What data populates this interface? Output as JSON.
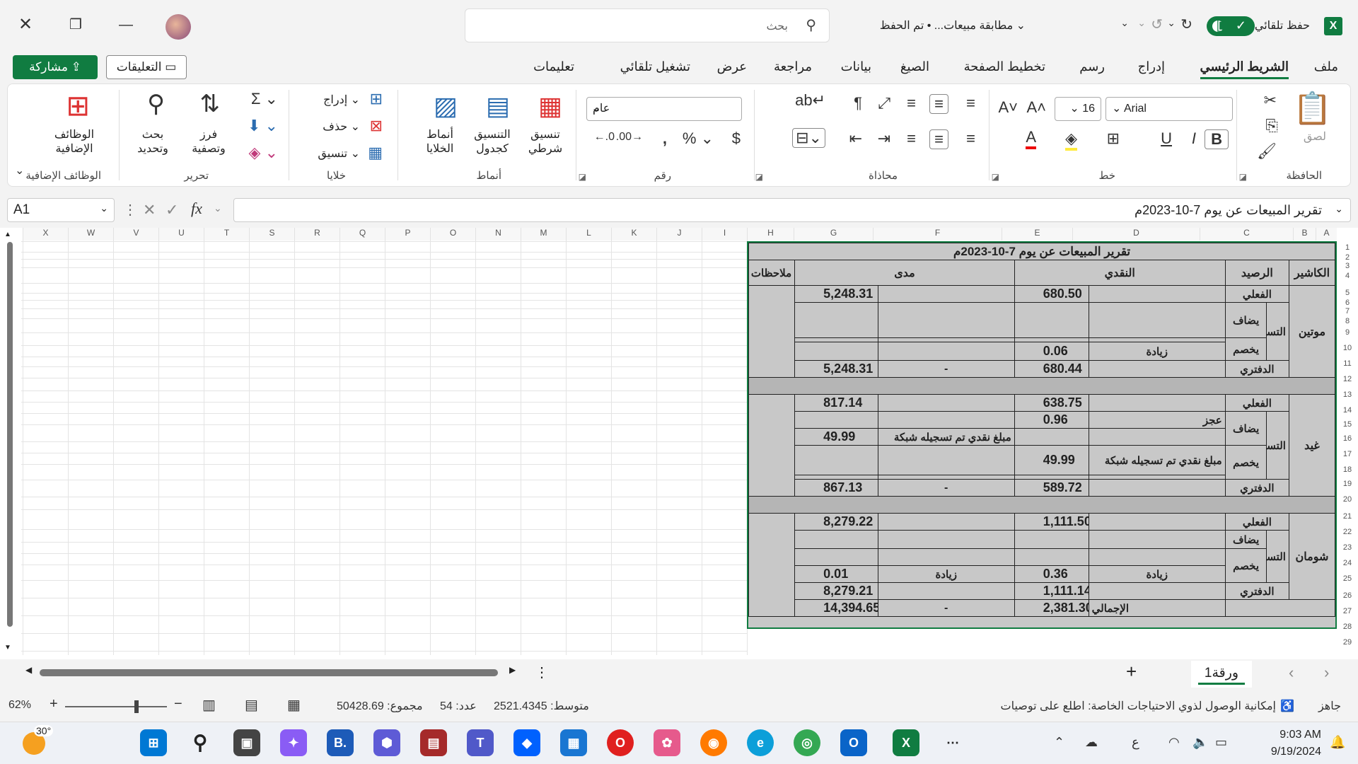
{
  "titlebar": {
    "autosave_label": "حفظ تلقائي",
    "doc_title": "مطابقة مبيعات...",
    "save_state": "• تم الحفظ",
    "search_placeholder": "بحث"
  },
  "tabs": [
    "ملف",
    "الشريط الرئيسي",
    "إدراج",
    "رسم",
    "تخطيط الصفحة",
    "الصيغ",
    "بيانات",
    "مراجعة",
    "عرض",
    "تشغيل تلقائي",
    "تعليمات"
  ],
  "actions": {
    "share": "مشاركة",
    "comments": "التعليقات"
  },
  "ribbon": {
    "clipboard": {
      "label": "الحافظة",
      "paste": "لصق"
    },
    "font": {
      "label": "خط",
      "name": "Arial",
      "size": "16"
    },
    "alignment": {
      "label": "محاذاة"
    },
    "number": {
      "label": "رقم",
      "format": "عام"
    },
    "styles": {
      "label": "أنماط",
      "conditional": "تنسيق شرطي",
      "table": "التنسيق كجدول",
      "cell": "أنماط الخلايا"
    },
    "cells": {
      "label": "خلايا",
      "insert": "إدراج",
      "delete": "حذف",
      "format": "تنسيق"
    },
    "editing": {
      "label": "تحرير",
      "sort": "فرز وتصفية",
      "find": "بحث وتحديد"
    },
    "addins": {
      "label": "الوظائف الإضافية",
      "button": "الوظائف الإضافية"
    }
  },
  "formula_bar": {
    "namebox": "A1",
    "value": "تقرير المبيعات عن يوم 7-10-2023م"
  },
  "columns": [
    "A",
    "B",
    "C",
    "D",
    "E",
    "F",
    "G",
    "H",
    "I",
    "J",
    "K",
    "L",
    "M",
    "N",
    "O",
    "P",
    "Q",
    "R",
    "S",
    "T",
    "U",
    "V",
    "W",
    "X"
  ],
  "report": {
    "title": "تقرير المبيعات عن يوم 7-10-2023م",
    "headers": {
      "cashier": "الكاشير",
      "balance": "الرصيد",
      "cash": "النقدي",
      "mada": "مدى",
      "notes": "ملاحظات"
    },
    "labels": {
      "actual": "الفعلي",
      "adjust": "التسويات",
      "add": "يضاف",
      "deduct": "يخصم",
      "book": "الدفتري",
      "total": "الإجمالي",
      "increase": "زيادة",
      "deficit": "عجز",
      "net_note": "مبلغ نقدي تم تسجيله شبكة",
      "dash": "-"
    },
    "cashiers": [
      {
        "name": "موتين",
        "actual_cash": "680.50",
        "actual_mada": "5,248.31",
        "deduct_cash": "0.06",
        "book_cash": "680.44",
        "book_mada": "5,248.31"
      },
      {
        "name": "غيد",
        "actual_cash": "638.75",
        "actual_mada": "817.14",
        "add_cash": "0.96",
        "add_mada": "49.99",
        "deduct_cash": "49.99",
        "book_cash": "589.72",
        "book_mada": "867.13"
      },
      {
        "name": "شومان",
        "actual_cash": "1,111.50",
        "actual_mada": "8,279.22",
        "deduct_cash": "0.36",
        "deduct_mada": "0.01",
        "book_cash": "1,111.14",
        "book_mada": "8,279.21"
      }
    ],
    "totals": {
      "cash": "2,381.30",
      "mada": "14,394.65"
    }
  },
  "sheet": {
    "tab": "ورقة1"
  },
  "status": {
    "ready": "جاهز",
    "accessibility": "إمكانية الوصول لذوي الاحتياجات الخاصة: اطلع على توصيات",
    "average": "متوسط: 2521.4345",
    "count": "عدد: 54",
    "sum": "مجموع: 50428.69",
    "zoom": "62%"
  },
  "taskbar": {
    "weather": "30°",
    "time": "9:03 AM",
    "date": "9/19/2024",
    "lang": "ع"
  },
  "colors": {
    "accent": "#107c41",
    "report_bg": "#c8c8c8"
  }
}
